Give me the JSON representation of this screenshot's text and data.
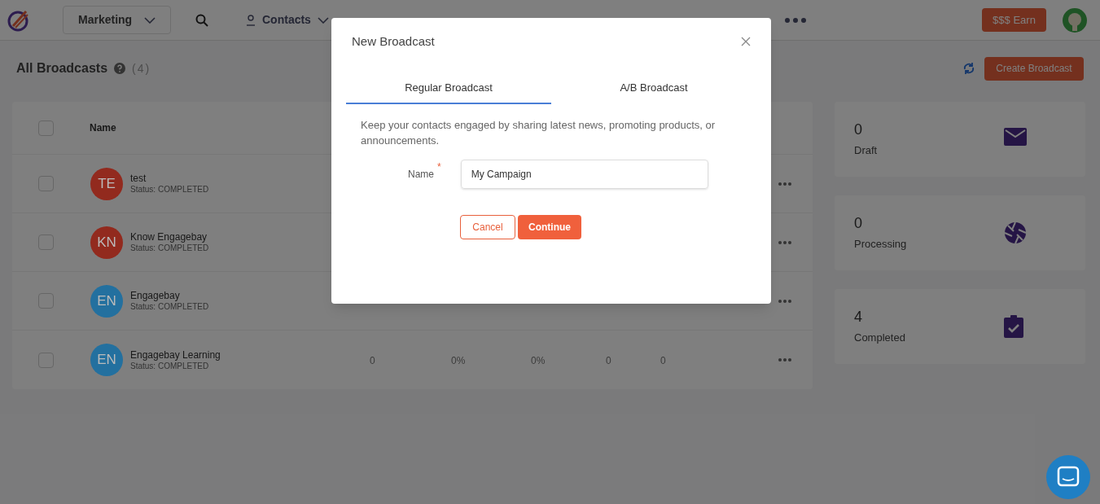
{
  "nav": {
    "workspace": "Marketing",
    "items": [
      {
        "label": "Contacts"
      }
    ],
    "earn_button": "$$$ Earn"
  },
  "header": {
    "title": "All Broadcasts",
    "count": "(4)",
    "create_button": "Create Broadcast"
  },
  "table": {
    "select_all_checked": false,
    "columns": [
      "Name"
    ],
    "rows": [
      {
        "checked": false,
        "initials": "TE",
        "color": "#922a1e",
        "name": "test",
        "status": "Status: COMPLETED",
        "cells": []
      },
      {
        "checked": false,
        "initials": "KN",
        "color": "#922a1e",
        "name": "Know Engagebay",
        "status": "Status: COMPLETED",
        "cells": []
      },
      {
        "checked": false,
        "initials": "EN",
        "color": "#23709f",
        "name": "Engagebay",
        "status": "Status: COMPLETED",
        "cells": []
      },
      {
        "checked": false,
        "initials": "EN",
        "color": "#23709f",
        "name": "Engagebay Learning",
        "status": "Status: COMPLETED",
        "cells": [
          "0",
          "0%",
          "0%",
          "0",
          "0"
        ]
      }
    ]
  },
  "stats": [
    {
      "value": "0",
      "label": "Draft"
    },
    {
      "value": "0",
      "label": "Processing"
    },
    {
      "value": "4",
      "label": "Completed"
    }
  ],
  "dialog": {
    "title": "New Broadcast",
    "tabs": [
      {
        "label": "Regular Broadcast",
        "selected": true
      },
      {
        "label": "A/B Broadcast",
        "selected": false
      }
    ],
    "description": "Keep your contacts engaged by sharing latest news, promoting products, or announcements.",
    "name_label": "Name",
    "required_mark": "*",
    "name_value": "My Campaign",
    "buttons": [
      "Cancel",
      "Continue"
    ]
  }
}
